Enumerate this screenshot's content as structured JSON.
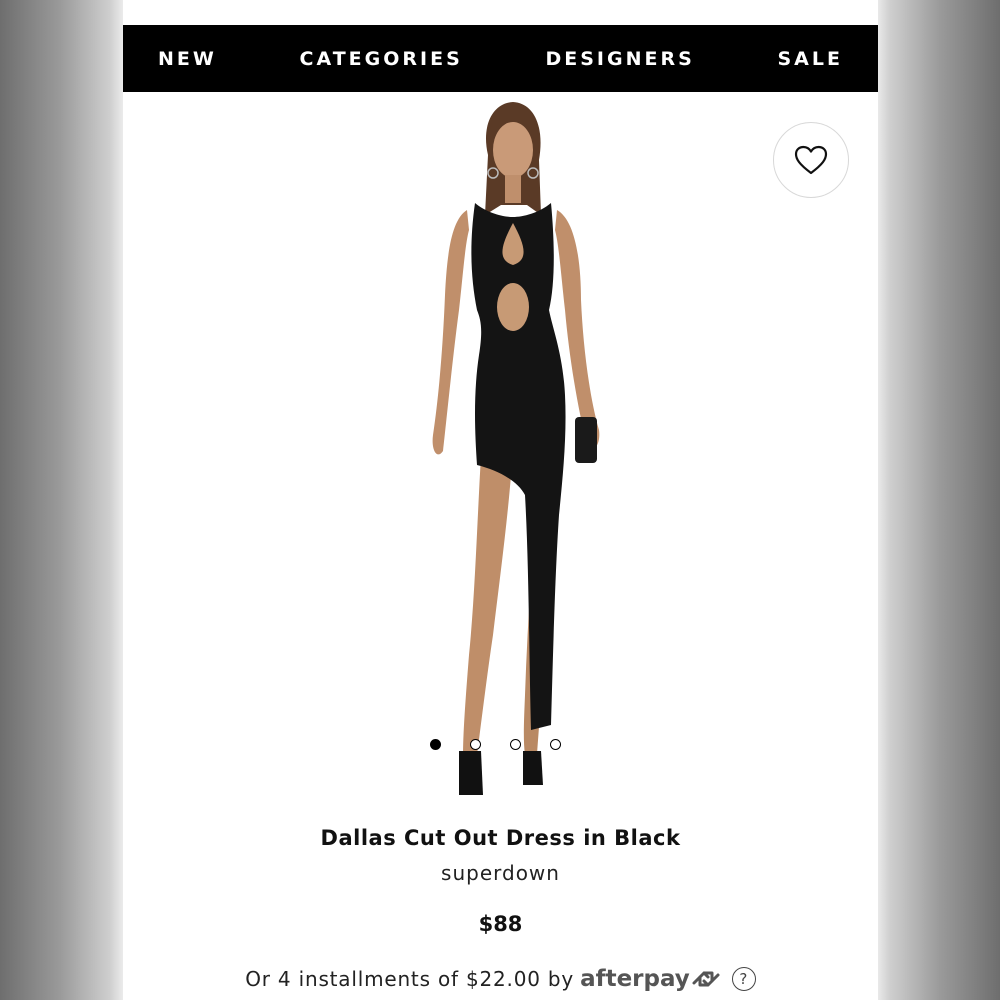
{
  "nav": {
    "items": [
      {
        "label": "NEW"
      },
      {
        "label": "CATEGORIES"
      },
      {
        "label": "DESIGNERS"
      },
      {
        "label": "SALE"
      }
    ]
  },
  "gallery": {
    "image_count": 4,
    "active_index": 0
  },
  "product": {
    "name": "Dallas Cut Out Dress in Black",
    "brand": "superdown",
    "price": "$88"
  },
  "payment": {
    "installment_text": "Or 4 installments of $22.00 by",
    "provider": "afterpay",
    "help_symbol": "?"
  },
  "icons": {
    "wishlist": "heart-icon",
    "payment_logo_mark": "afterpay-arrows-icon",
    "help": "question-mark-icon"
  },
  "colors": {
    "nav_background": "#000000",
    "nav_text": "#ffffff",
    "page_background": "#ffffff",
    "dress": "#141414"
  }
}
